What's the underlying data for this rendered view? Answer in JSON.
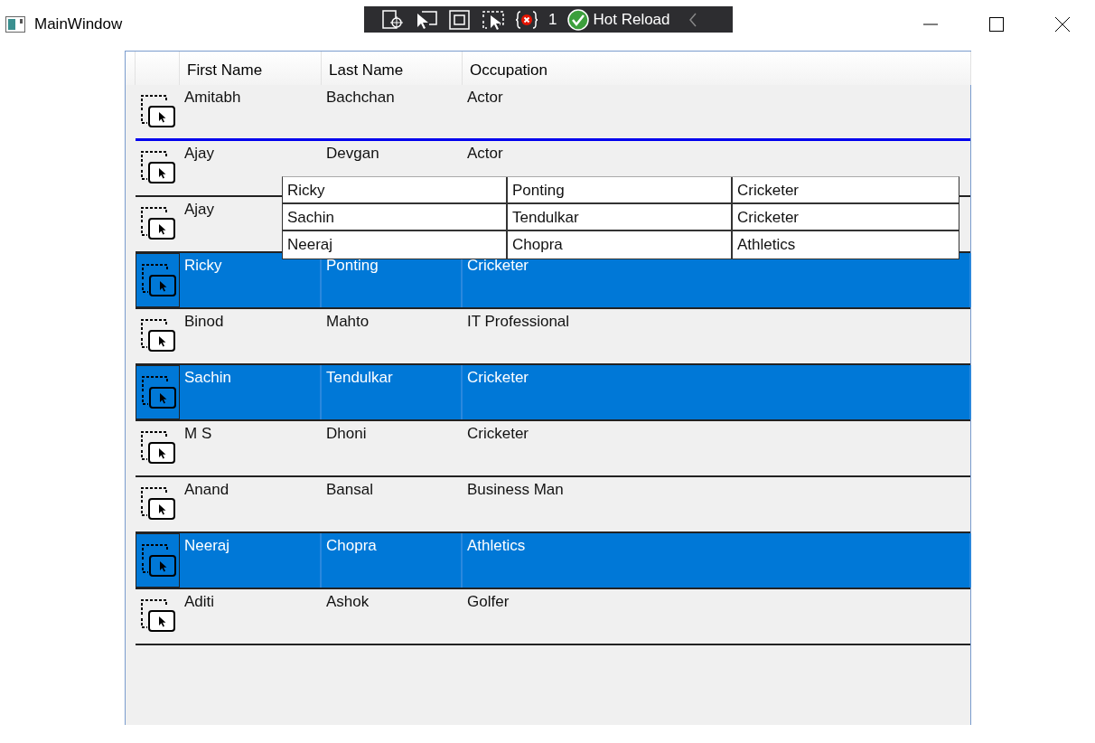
{
  "window": {
    "title": "MainWindow"
  },
  "debug_toolbar": {
    "error_count": "1",
    "hot_reload": "Hot Reload"
  },
  "grid": {
    "columns": [
      "First Name",
      "Last Name",
      "Occupation"
    ],
    "rows": [
      {
        "first": "Amitabh",
        "last": "Bachchan",
        "occupation": "Actor",
        "selected": false,
        "insert_marker": false
      },
      {
        "first": "Ajay",
        "last": "Devgan",
        "occupation": "Actor",
        "selected": false,
        "insert_marker": true
      },
      {
        "first": "Ajay",
        "selected": false,
        "insert_marker": false
      },
      {
        "first": "Ricky",
        "last": "Ponting",
        "occupation": "Cricketer",
        "selected": true,
        "insert_marker": false
      },
      {
        "first": "Binod",
        "last": "Mahto",
        "occupation": "IT Professional",
        "selected": false,
        "insert_marker": false
      },
      {
        "first": "Sachin",
        "last": "Tendulkar",
        "occupation": "Cricketer",
        "selected": true,
        "insert_marker": false
      },
      {
        "first": "M S",
        "last": "Dhoni",
        "occupation": "Cricketer",
        "selected": false,
        "insert_marker": false
      },
      {
        "first": "Anand",
        "last": "Bansal",
        "occupation": "Business Man",
        "selected": false,
        "insert_marker": false
      },
      {
        "first": "Neeraj",
        "last": "Chopra",
        "occupation": "Athletics",
        "selected": true,
        "insert_marker": false
      },
      {
        "first": "Aditi",
        "last": "Ashok",
        "occupation": "Golfer",
        "selected": false,
        "insert_marker": false
      }
    ]
  },
  "drag_preview": {
    "rows": [
      [
        "Ricky",
        "Ponting",
        "Cricketer"
      ],
      [
        "Sachin",
        "Tendulkar",
        "Cricketer"
      ],
      [
        "Neeraj",
        "Chopra",
        "Athletics"
      ]
    ]
  }
}
